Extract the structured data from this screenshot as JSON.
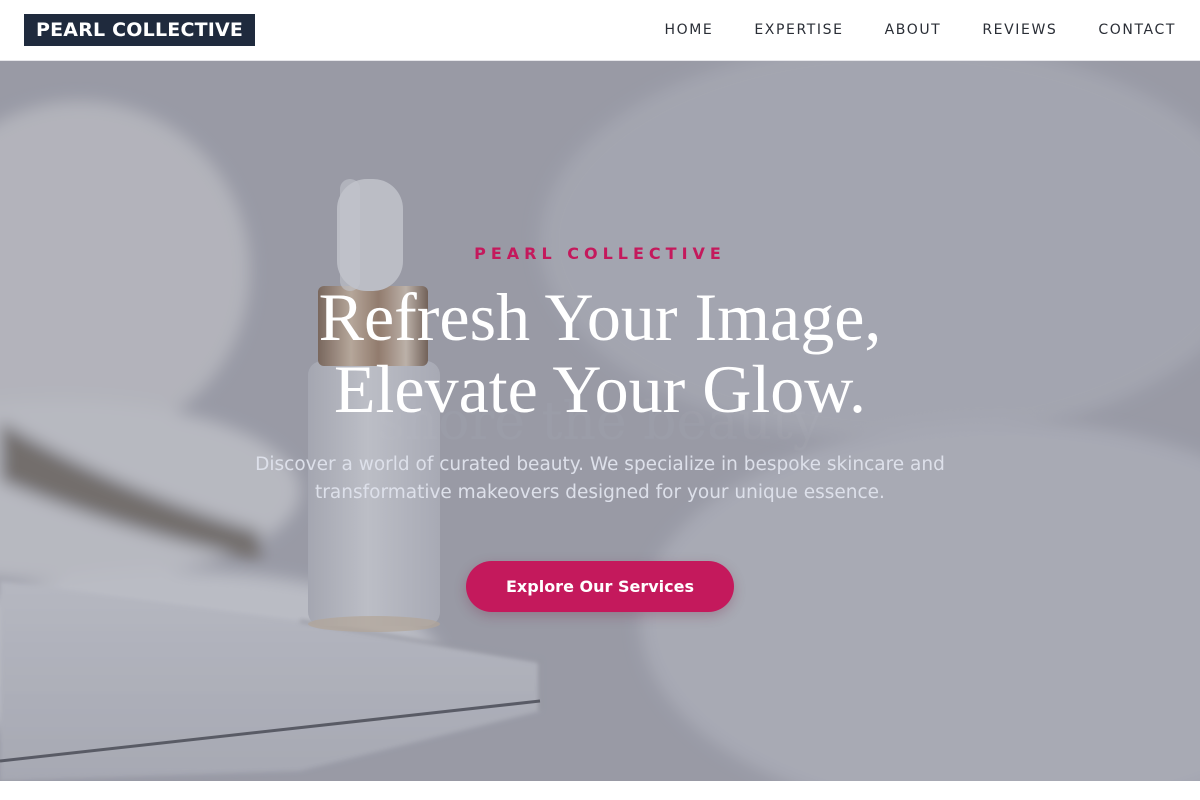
{
  "header": {
    "logo": "PEARL COLLECTIVE",
    "nav": [
      {
        "label": "HOME"
      },
      {
        "label": "EXPERTISE"
      },
      {
        "label": "ABOUT"
      },
      {
        "label": "REVIEWS"
      },
      {
        "label": "CONTACT"
      }
    ]
  },
  "hero": {
    "eyebrow": "PEARL COLLECTIVE",
    "headline_line1": "Refresh Your Image,",
    "headline_line2": "Elevate Your Glow.",
    "description": "Discover a world of curated beauty. We specialize in bespoke skincare and transformative makeovers designed for your unique essence.",
    "cta_label": "Explore Our Services",
    "background_image": "serum-dropper-bottle-on-marble-tray-with-towels"
  },
  "colors": {
    "accent": "#c4195c",
    "logo_bg": "#1f2a3d",
    "nav_text": "#2a2e36"
  }
}
